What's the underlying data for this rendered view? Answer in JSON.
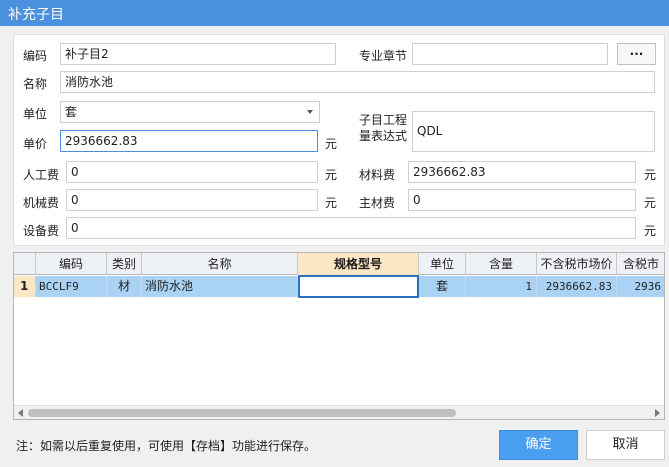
{
  "window": {
    "title": "补充子目"
  },
  "form": {
    "code_label": "编码",
    "code_value": "补子目2",
    "chapter_label": "专业章节",
    "chapter_value": "",
    "browse_label": "...",
    "name_label": "名称",
    "name_value": "消防水池",
    "unit_label": "单位",
    "unit_value": "套",
    "expr_label_line1": "子目工程",
    "expr_label_line2": "量表达式",
    "expr_value": "QDL",
    "price_label": "单价",
    "price_value": "2936662.83",
    "currency": "元",
    "labor_label": "人工费",
    "labor_value": "0",
    "material_label": "材料费",
    "material_value": "2936662.83",
    "machine_label": "机械费",
    "machine_value": "0",
    "main_material_label": "主材费",
    "main_material_value": "0",
    "equipment_label": "设备费",
    "equipment_value": "0"
  },
  "grid": {
    "columns": [
      "编码",
      "类别",
      "名称",
      "规格型号",
      "单位",
      "含量",
      "不含税市场价",
      "含税市"
    ],
    "active_column": "规格型号",
    "rows": [
      {
        "row_num": "1",
        "code": "BCCLF9",
        "category": "材",
        "name": "消防水池",
        "spec": "",
        "unit": "套",
        "qty": "1",
        "price_ex_tax": "2936662.83",
        "price_inc_tax": "2936"
      }
    ]
  },
  "footer": {
    "note": "注：如需以后重复使用，可使用【存档】功能进行保存。",
    "confirm_label": "确定",
    "cancel_label": "取消"
  },
  "colors": {
    "titlebar": "#4a90de",
    "primary_button": "#4a9ff0",
    "selected_row": "#a9d2f5",
    "active_header": "#fde6c4"
  }
}
